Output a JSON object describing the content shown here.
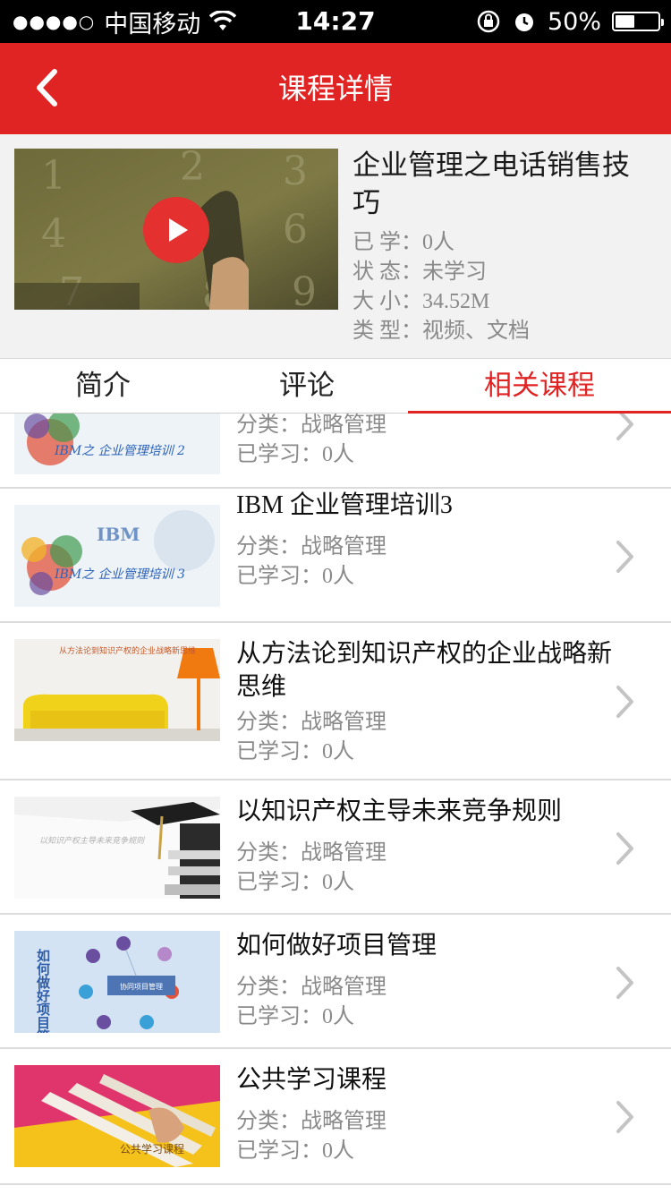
{
  "status_bar": {
    "signal_dots": "●●●●○",
    "carrier": "中国移动",
    "time": "14:27",
    "battery": "50%",
    "battery_level": 0.5
  },
  "nav": {
    "title": "课程详情"
  },
  "course": {
    "title": "企业管理之电话销售技巧",
    "learned_label": "已 学：",
    "learned_value": "0人",
    "status_label": "状 态：",
    "status_value": "未学习",
    "size_label": "大 小：",
    "size_value": "34.52M",
    "type_label": "类 型：",
    "type_value": "视频、文档"
  },
  "tabs": [
    {
      "label": "简介"
    },
    {
      "label": "评论"
    },
    {
      "label": "相关课程"
    }
  ],
  "related": [
    {
      "title": "",
      "category": "分类：战略管理",
      "learned": "已学习：0人",
      "thumb_text": "IBM之 企业管理培训 2"
    },
    {
      "title": "IBM 企业管理培训3",
      "category": "分类：战略管理",
      "learned": "已学习：0人",
      "thumb_text": "IBM之 企业管理培训 3",
      "thumb_brand": "IBM"
    },
    {
      "title": "从方法论到知识产权的企业战略新思维",
      "category": "分类：战略管理",
      "learned": "已学习：0人",
      "thumb_text": "从方法论到知识产权的企业战略新思维"
    },
    {
      "title": "以知识产权主导未来竞争规则",
      "category": "分类：战略管理",
      "learned": "已学习：0人",
      "thumb_text": "以知识产权主导未来竞争规则"
    },
    {
      "title": "如何做好项目管理",
      "category": "分类：战略管理",
      "learned": "已学习：0人",
      "thumb_text": "如何做好项目管理",
      "thumb_center": "协同项目管理"
    },
    {
      "title": "公共学习课程",
      "category": "分类：战略管理",
      "learned": "已学习：0人",
      "thumb_text": "公共学习课程"
    }
  ],
  "colors": {
    "accent": "#e02424",
    "meta_gray": "#8a8a8a",
    "header_bg": "#f2f2f2"
  }
}
